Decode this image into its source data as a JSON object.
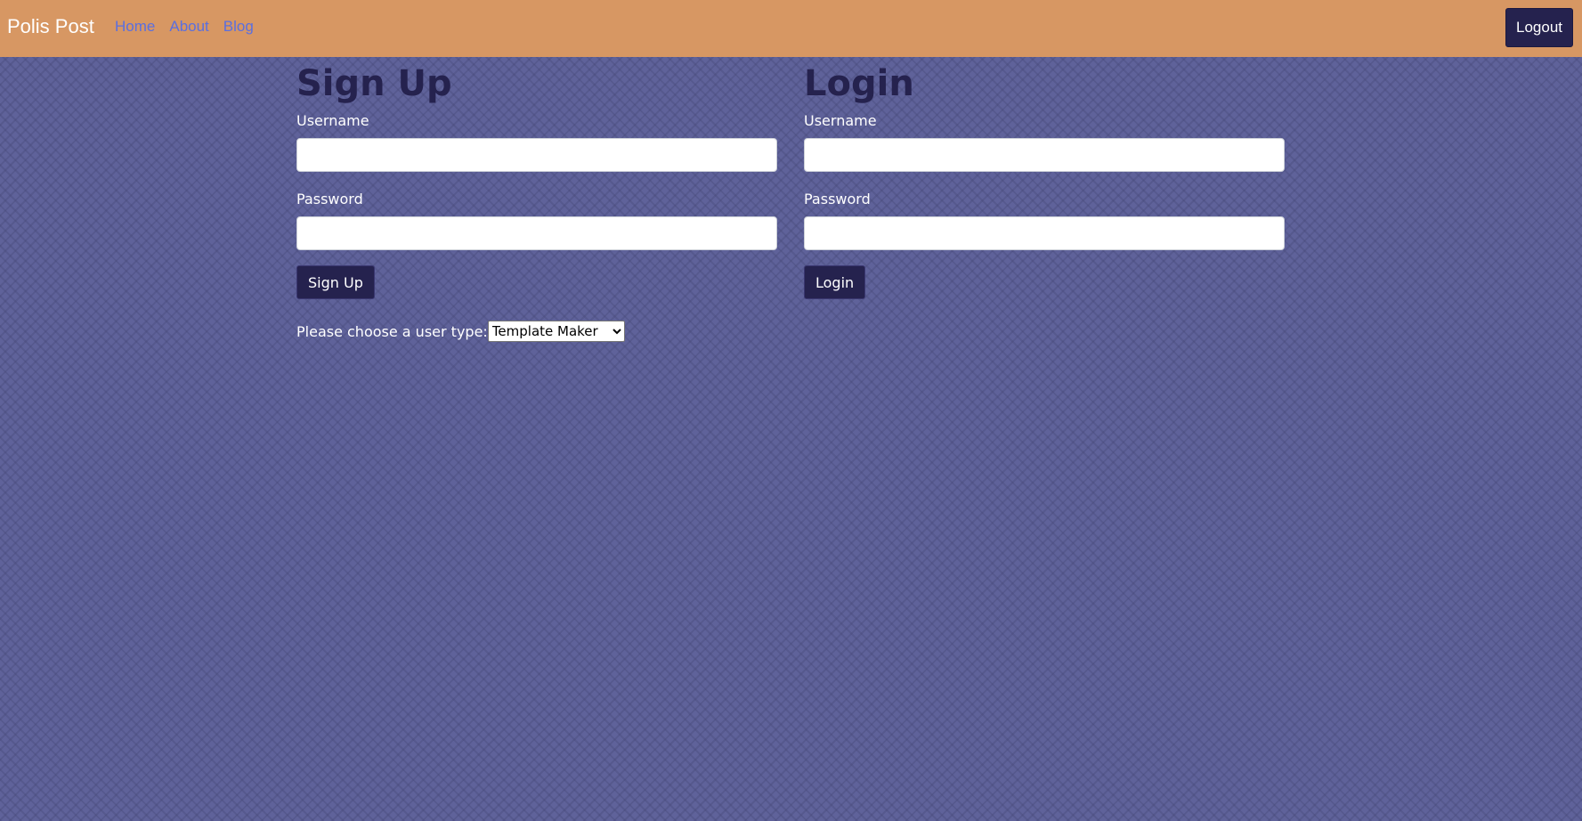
{
  "navbar": {
    "brand": "Polis Post",
    "links": [
      "Home",
      "About",
      "Blog"
    ],
    "logout_label": "Logout"
  },
  "signup": {
    "title": "Sign Up",
    "username_label": "Username",
    "username_value": "",
    "password_label": "Password",
    "password_value": "",
    "button_label": "Sign Up",
    "usertype_label": "Please choose a user type:",
    "usertype_selected": "Template Maker"
  },
  "login": {
    "title": "Login",
    "username_label": "Username",
    "username_value": "",
    "password_label": "Password",
    "password_value": "",
    "button_label": "Login"
  },
  "colors": {
    "navbar_bg": "#d79763",
    "page_bg": "#5f629a",
    "dark_accent": "#25224e",
    "link": "#5a6fe0"
  }
}
